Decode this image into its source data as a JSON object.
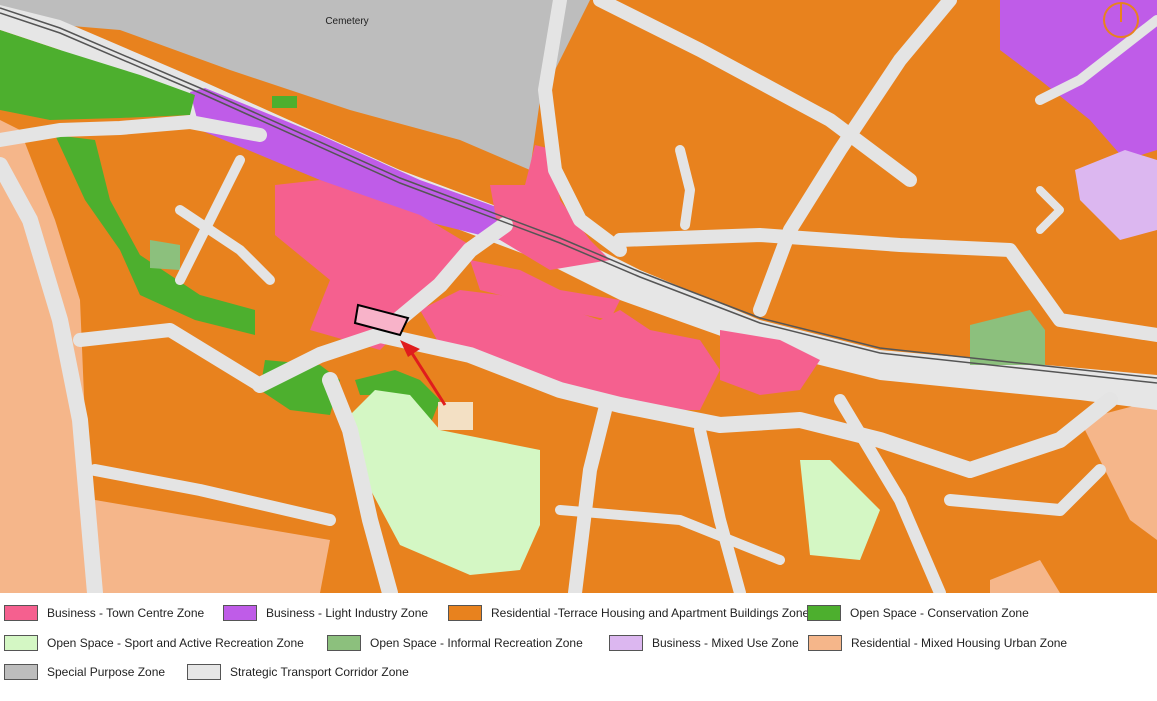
{
  "map": {
    "labels": {
      "cemetery": "Cemetery"
    },
    "colors": {
      "residential_terrace": "#e8821e",
      "road": "#e4e4e4",
      "business_town_centre": "#f5608f",
      "business_light_industry": "#bf5ce8",
      "open_space_conservation": "#4daf2e",
      "open_space_sport": "#d4f7c4",
      "open_space_informal": "#8cc07d",
      "business_mixed_use": "#dcb7f0",
      "residential_mixed_urban": "#f5b68a",
      "special_purpose": "#bdbdbd",
      "transport_corridor": "#e6e6e6",
      "rail": "#555555",
      "pointer_arrow": "#e01d1d"
    },
    "icons": {
      "north_arrow": "north-arrow-icon",
      "pointer": "red-arrow-icon"
    }
  },
  "legend": {
    "items": [
      {
        "label": "Business - Town Centre Zone",
        "color": "#f5608f"
      },
      {
        "label": "Business - Light Industry Zone",
        "color": "#bf5ce8"
      },
      {
        "label": "Residential -Terrace Housing and Apartment Buildings Zone",
        "color": "#e8821e"
      },
      {
        "label": "Open Space - Conservation Zone",
        "color": "#4daf2e"
      },
      {
        "label": "Open Space - Sport and Active Recreation Zone",
        "color": "#d4f7c4"
      },
      {
        "label": "Open Space - Informal Recreation Zone",
        "color": "#8cc07d"
      },
      {
        "label": "Business - Mixed Use Zone",
        "color": "#dcb7f0"
      },
      {
        "label": "Residential - Mixed Housing Urban Zone",
        "color": "#f5b68a"
      },
      {
        "label": "Special Purpose Zone",
        "color": "#bdbdbd"
      },
      {
        "label": "Strategic Transport Corridor Zone",
        "color": "#e6e6e6"
      }
    ]
  }
}
